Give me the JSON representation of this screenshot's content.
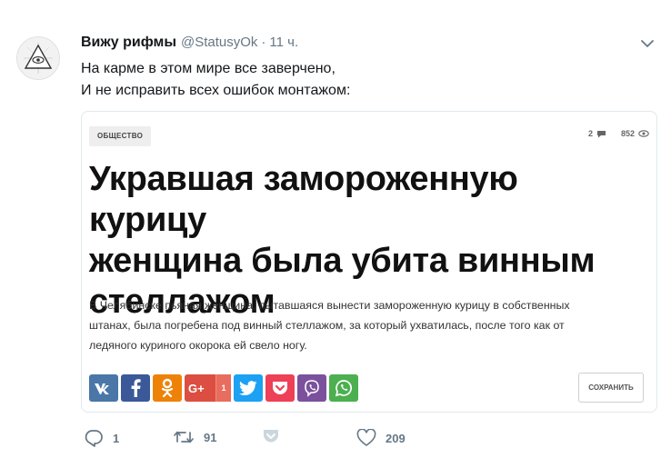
{
  "tweet": {
    "author_name": "Вижу рифмы",
    "handle": "@StatusyOk",
    "separator": "·",
    "time": "11 ч.",
    "text_lines": [
      "На карме в этом мире все заверчено,",
      "И не исправить всех ошибок монтажом:"
    ]
  },
  "card": {
    "tag": "ОБЩЕСТВО",
    "comments_count": "2",
    "views_count": "852",
    "headline_lines": [
      "Укравшая замороженную курицу",
      "женщина была убита винным",
      "стеллажом"
    ],
    "summary_lines": [
      "В Челябинске пьяная женщина, пытавшаяся вынести замороженную курицу в собственных",
      "штанах, была погребена под винный стеллажом, за который ухватилась, после того как от",
      "ледяного куриного окорока ей свело ногу."
    ],
    "share_buttons": [
      {
        "icon": "vk-icon",
        "glyph": "vk",
        "color": "#4a76a8"
      },
      {
        "icon": "facebook-icon",
        "glyph": "f",
        "color": "#3b5998"
      },
      {
        "icon": "odnoklassniki-icon",
        "glyph": "ok",
        "color": "#ee8208"
      },
      {
        "icon": "google-plus-icon",
        "glyph": "G+",
        "color": "#dc4e41",
        "count": "1"
      },
      {
        "icon": "twitter-icon",
        "glyph": "tw",
        "color": "#1da1f2"
      },
      {
        "icon": "pocket-icon",
        "glyph": "p",
        "color": "#ee4056"
      },
      {
        "icon": "viber-icon",
        "glyph": "v",
        "color": "#7b519d"
      },
      {
        "icon": "whatsapp-icon",
        "glyph": "w",
        "color": "#4caf50"
      }
    ],
    "save_label": "СОХРАНИТЬ"
  },
  "actions": {
    "replies": "1",
    "retweets": "91",
    "likes": "209"
  },
  "colors": {
    "text": "#14171a",
    "secondary": "#657786",
    "border": "#e1e8ed"
  }
}
